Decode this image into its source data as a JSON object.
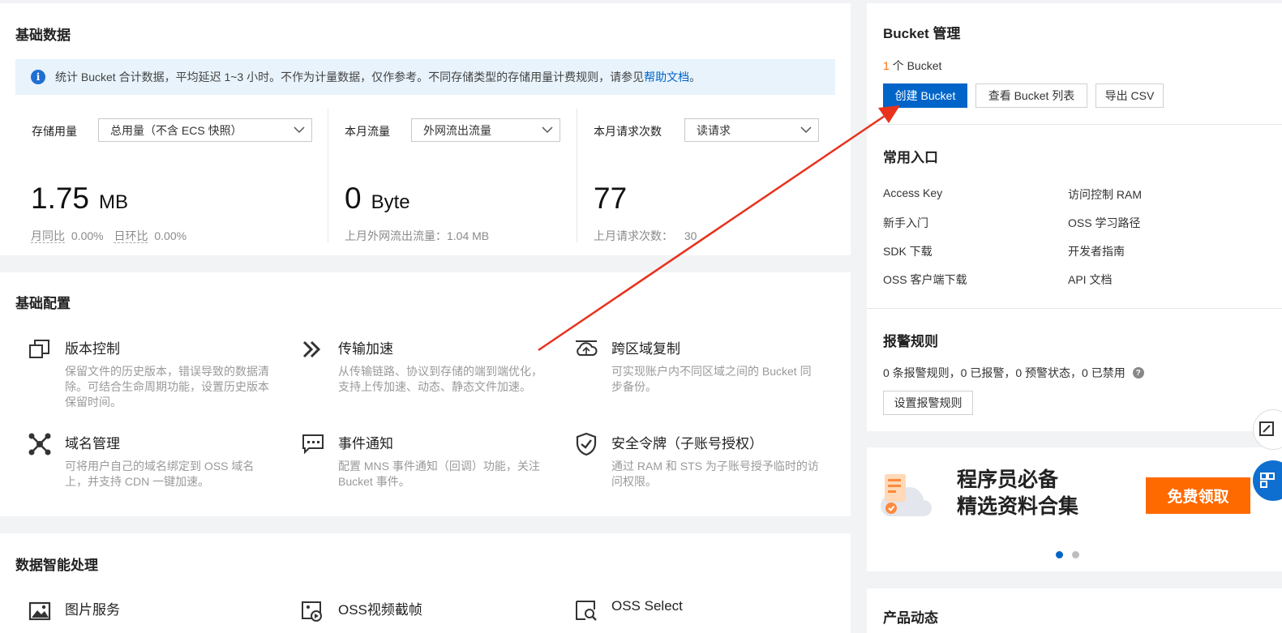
{
  "basic_data": {
    "title": "基础数据",
    "info_text": "统计 Bucket 合计数据，平均延迟 1~3 小时。不作为计量数据，仅作参考。不同存储类型的存储用量计费规则，请参见",
    "info_link": "帮助文档",
    "info_end": "。",
    "storage": {
      "label": "存储用量",
      "select": "总用量（不含 ECS 快照）",
      "value": "1.75",
      "unit": "MB",
      "yoy_label": "月同比",
      "yoy_value": "0.00%",
      "mom_label": "日环比",
      "mom_value": "0.00%"
    },
    "traffic": {
      "label": "本月流量",
      "select": "外网流出流量",
      "value": "0",
      "unit": "Byte",
      "sub": "上月外网流出流量：1.04 MB"
    },
    "requests": {
      "label": "本月请求次数",
      "select": "读请求",
      "value": "77",
      "sub_label": "上月请求次数：",
      "sub_value": "30"
    }
  },
  "basic_config": {
    "title": "基础配置",
    "features": [
      {
        "title": "版本控制",
        "desc": "保留文件的历史版本，错误导致的数据清除。可结合生命周期功能，设置历史版本保留时间。",
        "icon": "copy-icon"
      },
      {
        "title": "传输加速",
        "desc": "从传输链路、协议到存储的端到端优化，支持上传加速、动态、静态文件加速。",
        "icon": "double-chevron-icon"
      },
      {
        "title": "跨区域复制",
        "desc": "可实现账户内不同区域之间的 Bucket 同步备份。",
        "icon": "cloud-sync-icon"
      },
      {
        "title": "域名管理",
        "desc": "可将用户自己的域名绑定到 OSS 域名上，并支持 CDN 一键加速。",
        "icon": "network-icon"
      },
      {
        "title": "事件通知",
        "desc": "配置 MNS 事件通知（回调）功能，关注 Bucket 事件。",
        "icon": "message-icon"
      },
      {
        "title": "安全令牌（子账号授权）",
        "desc": "通过 RAM 和 STS 为子账号授予临时的访问权限。",
        "icon": "shield-icon"
      }
    ]
  },
  "data_intel": {
    "title": "数据智能处理",
    "items": [
      {
        "title": "图片服务",
        "icon": "image-icon"
      },
      {
        "title": "OSS视频截帧",
        "icon": "video-frame-icon"
      },
      {
        "title": "OSS Select",
        "icon": "search-doc-icon"
      }
    ]
  },
  "bucket_mgmt": {
    "title": "Bucket 管理",
    "count": "1",
    "count_suffix": " 个 Bucket",
    "create_btn": "创建 Bucket",
    "list_btn": "查看 Bucket 列表",
    "export_btn": "导出 CSV"
  },
  "common_entries": {
    "title": "常用入口",
    "items": [
      "Access Key",
      "访问控制 RAM",
      "新手入门",
      "OSS 学习路径",
      "SDK 下载",
      "开发者指南",
      "OSS 客户端下载",
      "API 文档"
    ]
  },
  "alerts": {
    "title": "报警规则",
    "summary": "0 条报警规则，0 已报警，0 预警状态，0 已禁用",
    "set_btn": "设置报警规则"
  },
  "promo": {
    "line1": "程序员必备",
    "line2": "精选资料合集",
    "button": "免费领取"
  },
  "news": {
    "title": "产品动态"
  },
  "colors": {
    "primary": "#0064c8",
    "promo_orange": "#ff6a00",
    "count_orange": "#ff6a00",
    "annotation_arrow": "#e8321d"
  }
}
